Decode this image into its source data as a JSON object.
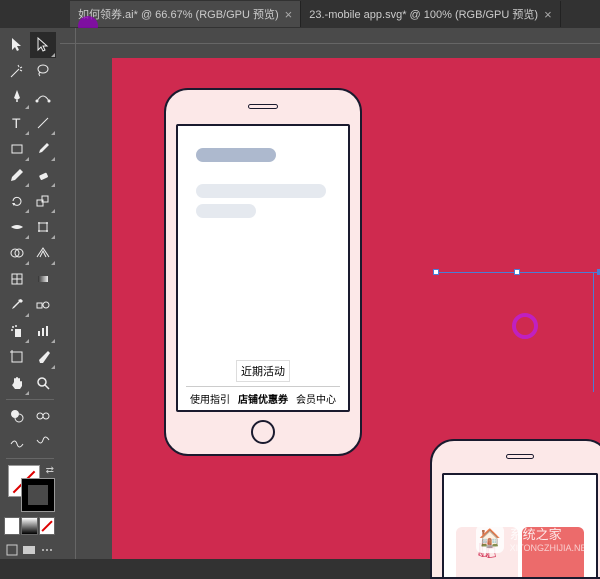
{
  "tabs": [
    {
      "label": "如何领券.ai* @ 66.67% (RGB/GPU 预览)",
      "active": true
    },
    {
      "label": "23.-mobile app.svg* @ 100% (RGB/GPU 预览)",
      "active": false
    }
  ],
  "tools": {
    "row1": [
      "selection",
      "direct-selection"
    ],
    "row2": [
      "magic-wand",
      "lasso"
    ],
    "row3": [
      "pen",
      "curvature"
    ],
    "row4": [
      "type",
      "line"
    ],
    "row5": [
      "rectangle",
      "paintbrush"
    ],
    "row6": [
      "shaper",
      "eraser"
    ],
    "row7": [
      "rotate",
      "scale"
    ],
    "row8": [
      "width",
      "free-transform"
    ],
    "row9": [
      "shape-builder",
      "perspective"
    ],
    "row10": [
      "mesh",
      "gradient"
    ],
    "row11": [
      "eyedropper",
      "blend"
    ],
    "row12": [
      "symbol-sprayer",
      "column-graph"
    ],
    "row13": [
      "artboard",
      "slice"
    ],
    "row14": [
      "hand",
      "zoom"
    ],
    "row15": [
      "toggle-fill",
      "toggle-stroke"
    ]
  },
  "phone1": {
    "activity_label": "近期活动",
    "tabs": [
      "使用指引",
      "店铺优惠券",
      "会员中心"
    ]
  },
  "watermark": {
    "title": "系统之家",
    "subtitle": "XITONGZHIJIA.NET"
  }
}
